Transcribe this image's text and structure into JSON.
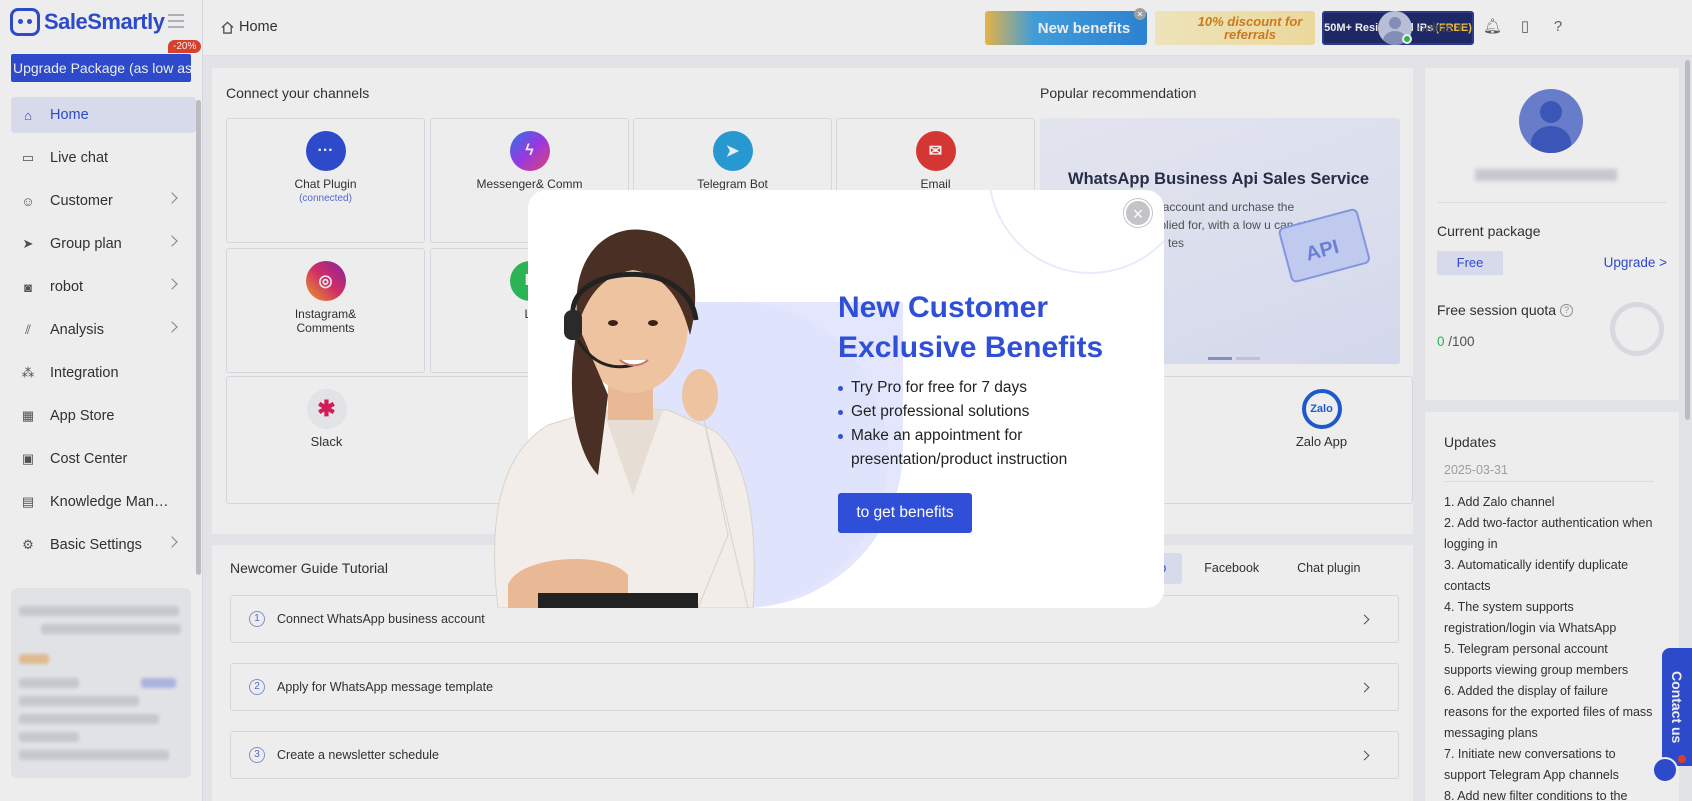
{
  "app": {
    "name": "SaleSmartly"
  },
  "sidebar": {
    "upgrade_label": "Upgrade Package (as low as",
    "upgrade_badge": "-20%",
    "items": [
      {
        "label": "Home",
        "icon": "home-icon",
        "active": true
      },
      {
        "label": "Live chat",
        "icon": "chat-icon"
      },
      {
        "label": "Customer",
        "icon": "users-icon",
        "has_children": true
      },
      {
        "label": "Group plan",
        "icon": "send-icon",
        "has_children": true
      },
      {
        "label": "robot",
        "icon": "robot-icon",
        "has_children": true
      },
      {
        "label": "Analysis",
        "icon": "analytics-icon",
        "has_children": true
      },
      {
        "label": "Integration",
        "icon": "integration-icon"
      },
      {
        "label": "App Store",
        "icon": "apps-icon"
      },
      {
        "label": "Cost Center",
        "icon": "wallet-icon"
      },
      {
        "label": "Knowledge Man…",
        "icon": "book-icon"
      },
      {
        "label": "Basic Settings",
        "icon": "gear-icon",
        "has_children": true
      }
    ]
  },
  "header": {
    "breadcrumb": "Home",
    "promo_new_benefits": "New benefits",
    "promo_discount": "10% discount for referrals",
    "promo_ips": "50M+ Residential IPs",
    "promo_ips_tag": "(FREE)",
    "status": "online"
  },
  "channels": {
    "title": "Connect your channels",
    "items": [
      {
        "label": "Chat Plugin",
        "sub": "(connected)",
        "color": "#2f4fd8"
      },
      {
        "label": "Messenger& Comm",
        "color": "#7a3cf0"
      },
      {
        "label": "Telegram Bot",
        "color": "#2aa3e0"
      },
      {
        "label": "Email",
        "color": "#e53935"
      },
      {
        "label": "Instagram& Comments",
        "color": "#e1306c"
      },
      {
        "label": "LI",
        "color": "#2ec05b"
      },
      {
        "label": "Slack",
        "color": "#ffffff"
      },
      {
        "label": "Zalo App",
        "color": "#1e5fd8"
      }
    ]
  },
  "recommendation": {
    "title": "Popular recommendation",
    "card_title": "WhatsApp Business Api Sales Service",
    "card_desc": "usiness Manager account and urchase the commercial Api pplied for, with a low u can start commercial use in tes"
  },
  "guide": {
    "title": "Newcomer Guide Tutorial",
    "tabs": [
      "App",
      "Facebook",
      "Chat plugin"
    ],
    "steps": [
      {
        "num": "1",
        "label": "Connect WhatsApp business account"
      },
      {
        "num": "2",
        "label": "Apply for WhatsApp message template"
      },
      {
        "num": "3",
        "label": "Create a newsletter schedule"
      }
    ]
  },
  "account": {
    "package_label": "Current package",
    "package_value": "Free",
    "upgrade_link": "Upgrade >",
    "quota_label": "Free session quota",
    "quota_used": "0",
    "quota_total": " /100"
  },
  "updates": {
    "title": "Updates",
    "date": "2025-03-31",
    "items": [
      "1. Add Zalo channel",
      "2. Add two-factor authentication when logging in",
      "3. Automatically identify duplicate contacts",
      "4. The system supports registration/login via WhatsApp",
      "5. Telegram personal account supports viewing group members",
      "6. Added the display of failure reasons for the exported files of mass messaging plans",
      "7. Initiate new conversations to support Telegram App channels",
      "8. Add new filter conditions to the"
    ]
  },
  "contact_tab": "Contact us",
  "modal": {
    "title_line1": "New Customer",
    "title_line2": "Exclusive Benefits",
    "bullets": [
      "Try Pro for free for 7 days",
      "Get professional solutions",
      "Make an appointment for presentation/product instruction"
    ],
    "cta": "to get benefits",
    "close": "×"
  }
}
